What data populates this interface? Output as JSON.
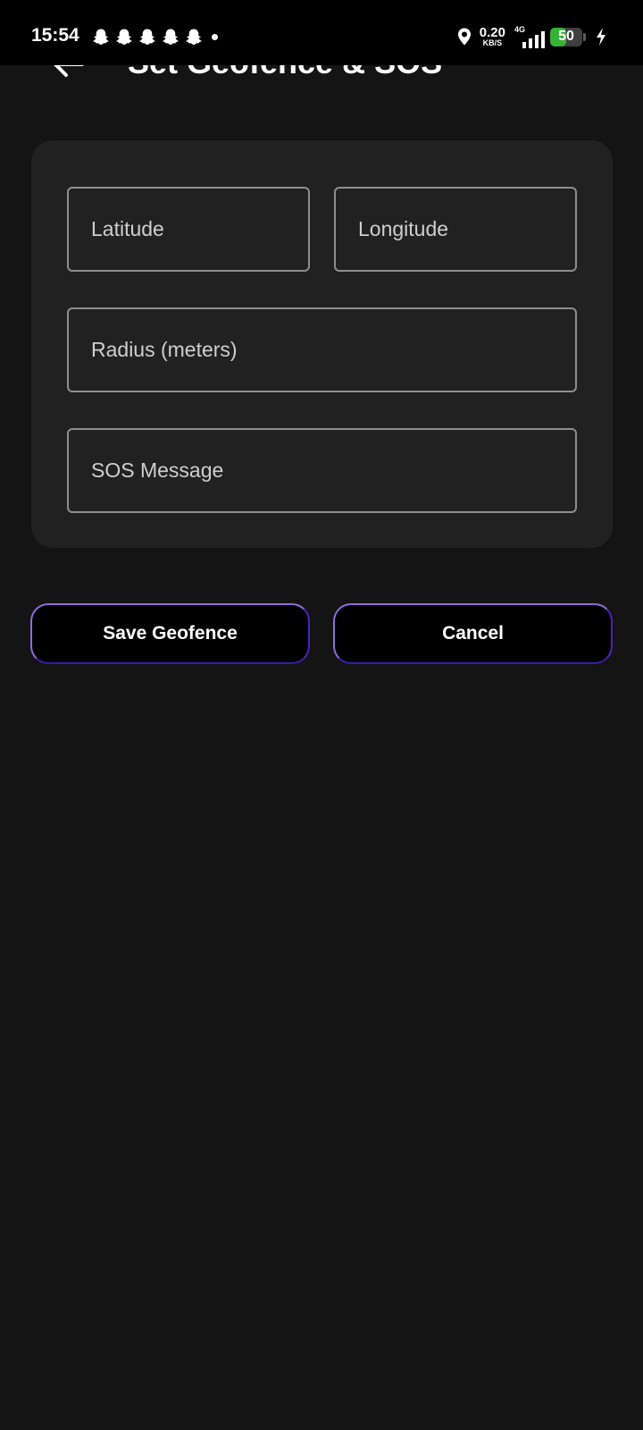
{
  "status_bar": {
    "time": "15:54",
    "notification_icons": [
      "snapchat-icon",
      "snapchat-icon",
      "snapchat-icon",
      "snapchat-icon",
      "snapchat-icon"
    ],
    "net_speed_value": "0.20",
    "net_speed_unit": "KB/S",
    "network_type": "4G",
    "battery_level": "50",
    "battery_fraction": 0.5,
    "battery_color": "#36b336"
  },
  "header": {
    "title": "Set Geofence & SOS",
    "back_icon": "arrow-back-icon"
  },
  "form": {
    "latitude_placeholder": "Latitude",
    "longitude_placeholder": "Longitude",
    "radius_placeholder": "Radius (meters)",
    "sos_placeholder": "SOS Message"
  },
  "actions": {
    "save_label": "Save Geofence",
    "cancel_label": "Cancel"
  },
  "colors": {
    "background": "#141414",
    "card": "#212121",
    "field_border": "#8e8e8e",
    "button_border_accent": "#8f6cd9"
  }
}
